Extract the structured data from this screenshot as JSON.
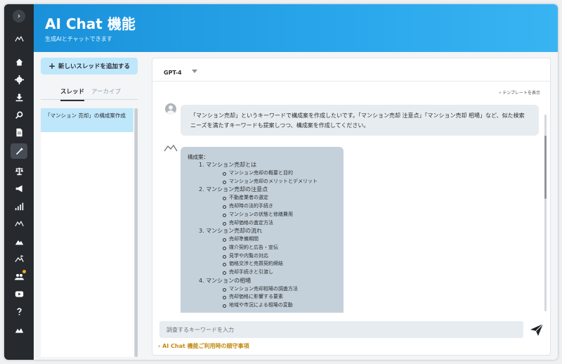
{
  "rail": {
    "toggle": "›",
    "items": [
      "logo",
      "home",
      "gear",
      "download",
      "search",
      "document",
      "magic-wand",
      "scale",
      "megaphone",
      "signal-bars",
      "mountain-logo",
      "landscape",
      "flag-mountain",
      "team",
      "youtube",
      "help",
      "mountain-range"
    ],
    "active": "magic-wand",
    "badge_color": "#f5a623"
  },
  "header": {
    "title": "AI Chat 機能",
    "subtitle": "生成AIとチャットできます"
  },
  "threads": {
    "add_label": "新しいスレッドを追加する",
    "tab_thread": "スレッド",
    "tab_archive": "アーカイブ",
    "items": [
      "「マンション 売却」の構成案作成"
    ]
  },
  "chat": {
    "model": "GPT-4",
    "template_link": "テンプレートを表示",
    "user_message": "「マンション売却」というキーワードで構成案を作成したいです。「マンション売却 注意点」「マンション売却 相場」など、似た検索ニーズを満たすキーワードも提案しつつ、構成案を作成してください。",
    "ai_reply": {
      "title": "構成案：",
      "sections": [
        {
          "head": "1. マンション売却とは",
          "items": [
            "マンション売却の概要と目的",
            "マンション売却のメリットとデメリット"
          ]
        },
        {
          "head": "2. マンション売却の注意点",
          "items": [
            "不動産業者の選定",
            "売却時の法的手続き",
            "マンションの状態と修繕費用",
            "売却価格の査定方法"
          ]
        },
        {
          "head": "3. マンション売却の流れ",
          "items": [
            "売却準備期間",
            "媒介契約と広告・宣伝",
            "見学や内覧の対応",
            "価格交渉と売買契約締結",
            "売却手続きと引渡し"
          ]
        },
        {
          "head": "4. マンションの相場",
          "items": [
            "マンション売却相場の調査方法",
            "売却価格に影響する要素",
            "地域や市況による相場の変動"
          ]
        }
      ]
    },
    "input_placeholder": "調査するキーワードを入力",
    "rules_link": "AI Chat 機能ご利用時の順守事項"
  },
  "colors": {
    "header_blue": "#1a91da",
    "rail_dark": "#262a2f",
    "selected_light_blue": "#bfe7fb",
    "ai_bubble": "#c5d1da",
    "rules_gold": "#c38a12"
  }
}
